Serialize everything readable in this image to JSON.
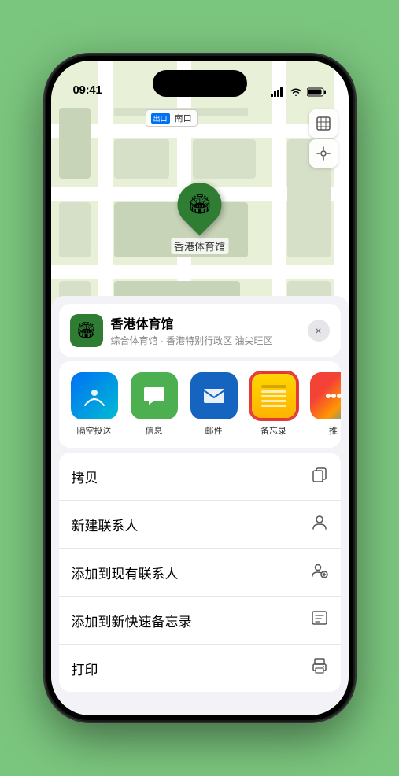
{
  "status_bar": {
    "time": "09:41",
    "signal": "●●●●",
    "wifi": "WiFi",
    "battery": "Battery"
  },
  "map": {
    "label_badge": "出口",
    "label_text": "南口",
    "location_name": "香港体育馆",
    "marker_emoji": "🏟"
  },
  "location_card": {
    "icon_emoji": "🏟",
    "name": "香港体育馆",
    "subtitle": "综合体育馆 · 香港特别行政区 油尖旺区",
    "close_label": "×"
  },
  "share_items": [
    {
      "id": "airdrop",
      "label": "隔空投送",
      "type": "airdrop"
    },
    {
      "id": "message",
      "label": "信息",
      "type": "message"
    },
    {
      "id": "mail",
      "label": "邮件",
      "type": "mail"
    },
    {
      "id": "notes",
      "label": "备忘录",
      "type": "notes",
      "selected": true
    },
    {
      "id": "more",
      "label": "推",
      "type": "more"
    }
  ],
  "actions": [
    {
      "id": "copy",
      "label": "拷贝",
      "icon": "📋"
    },
    {
      "id": "new-contact",
      "label": "新建联系人",
      "icon": "👤"
    },
    {
      "id": "add-contact",
      "label": "添加到现有联系人",
      "icon": "👥"
    },
    {
      "id": "quick-note",
      "label": "添加到新快速备忘录",
      "icon": "📝"
    },
    {
      "id": "print",
      "label": "打印",
      "icon": "🖨"
    }
  ]
}
